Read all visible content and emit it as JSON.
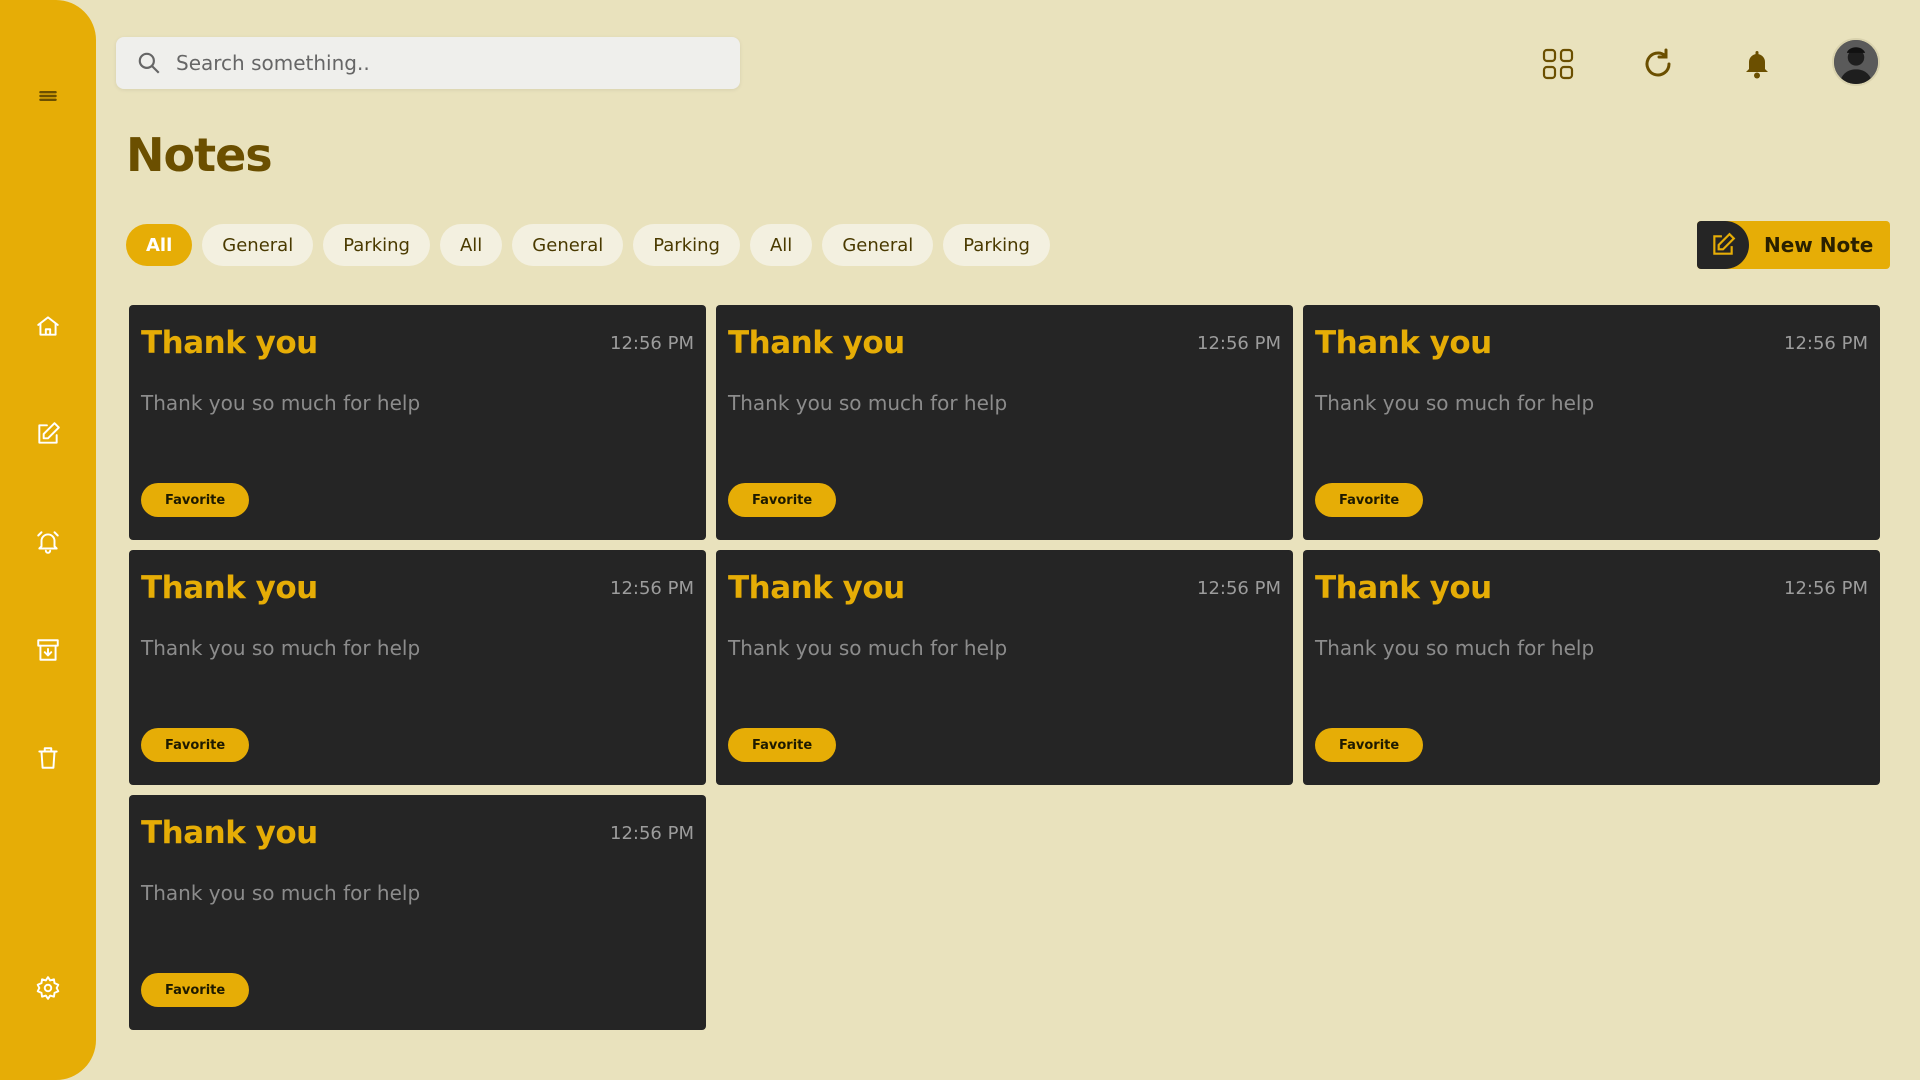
{
  "sidebar": {
    "items": [
      {
        "name": "menu-icon"
      },
      {
        "name": "home-icon"
      },
      {
        "name": "edit-note-icon"
      },
      {
        "name": "reminder-bell-icon"
      },
      {
        "name": "archive-icon"
      },
      {
        "name": "trash-icon"
      },
      {
        "name": "settings-icon"
      }
    ]
  },
  "search": {
    "placeholder": "Search something.."
  },
  "header": {
    "icons": [
      "grid-view-icon",
      "refresh-icon",
      "notification-bell-icon",
      "avatar"
    ]
  },
  "page": {
    "title": "Notes"
  },
  "filters": [
    {
      "label": "All",
      "active": true
    },
    {
      "label": "General",
      "active": false
    },
    {
      "label": "Parking",
      "active": false
    },
    {
      "label": "All",
      "active": false
    },
    {
      "label": "General",
      "active": false
    },
    {
      "label": "Parking",
      "active": false
    },
    {
      "label": "All",
      "active": false
    },
    {
      "label": "General",
      "active": false
    },
    {
      "label": "Parking",
      "active": false
    }
  ],
  "new_note": {
    "label": "New Note"
  },
  "notes": [
    {
      "title": "Thank you",
      "time": "12:56 PM",
      "body": "Thank you so much for help",
      "badge": "Favorite"
    },
    {
      "title": "Thank you",
      "time": "12:56 PM",
      "body": "Thank you so much for help",
      "badge": "Favorite"
    },
    {
      "title": "Thank you",
      "time": "12:56 PM",
      "body": "Thank you so much for help",
      "badge": "Favorite"
    },
    {
      "title": "Thank you",
      "time": "12:56 PM",
      "body": "Thank you so much for help",
      "badge": "Favorite"
    },
    {
      "title": "Thank you",
      "time": "12:56 PM",
      "body": "Thank you so much for help",
      "badge": "Favorite"
    },
    {
      "title": "Thank you",
      "time": "12:56 PM",
      "body": "Thank you so much for help",
      "badge": "Favorite"
    },
    {
      "title": "Thank you",
      "time": "12:56 PM",
      "body": "Thank you so much for help",
      "badge": "Favorite"
    }
  ],
  "colors": {
    "accent": "#e6ad06",
    "background": "#e9e2bd",
    "card": "#252525",
    "title": "#6b4f00"
  }
}
